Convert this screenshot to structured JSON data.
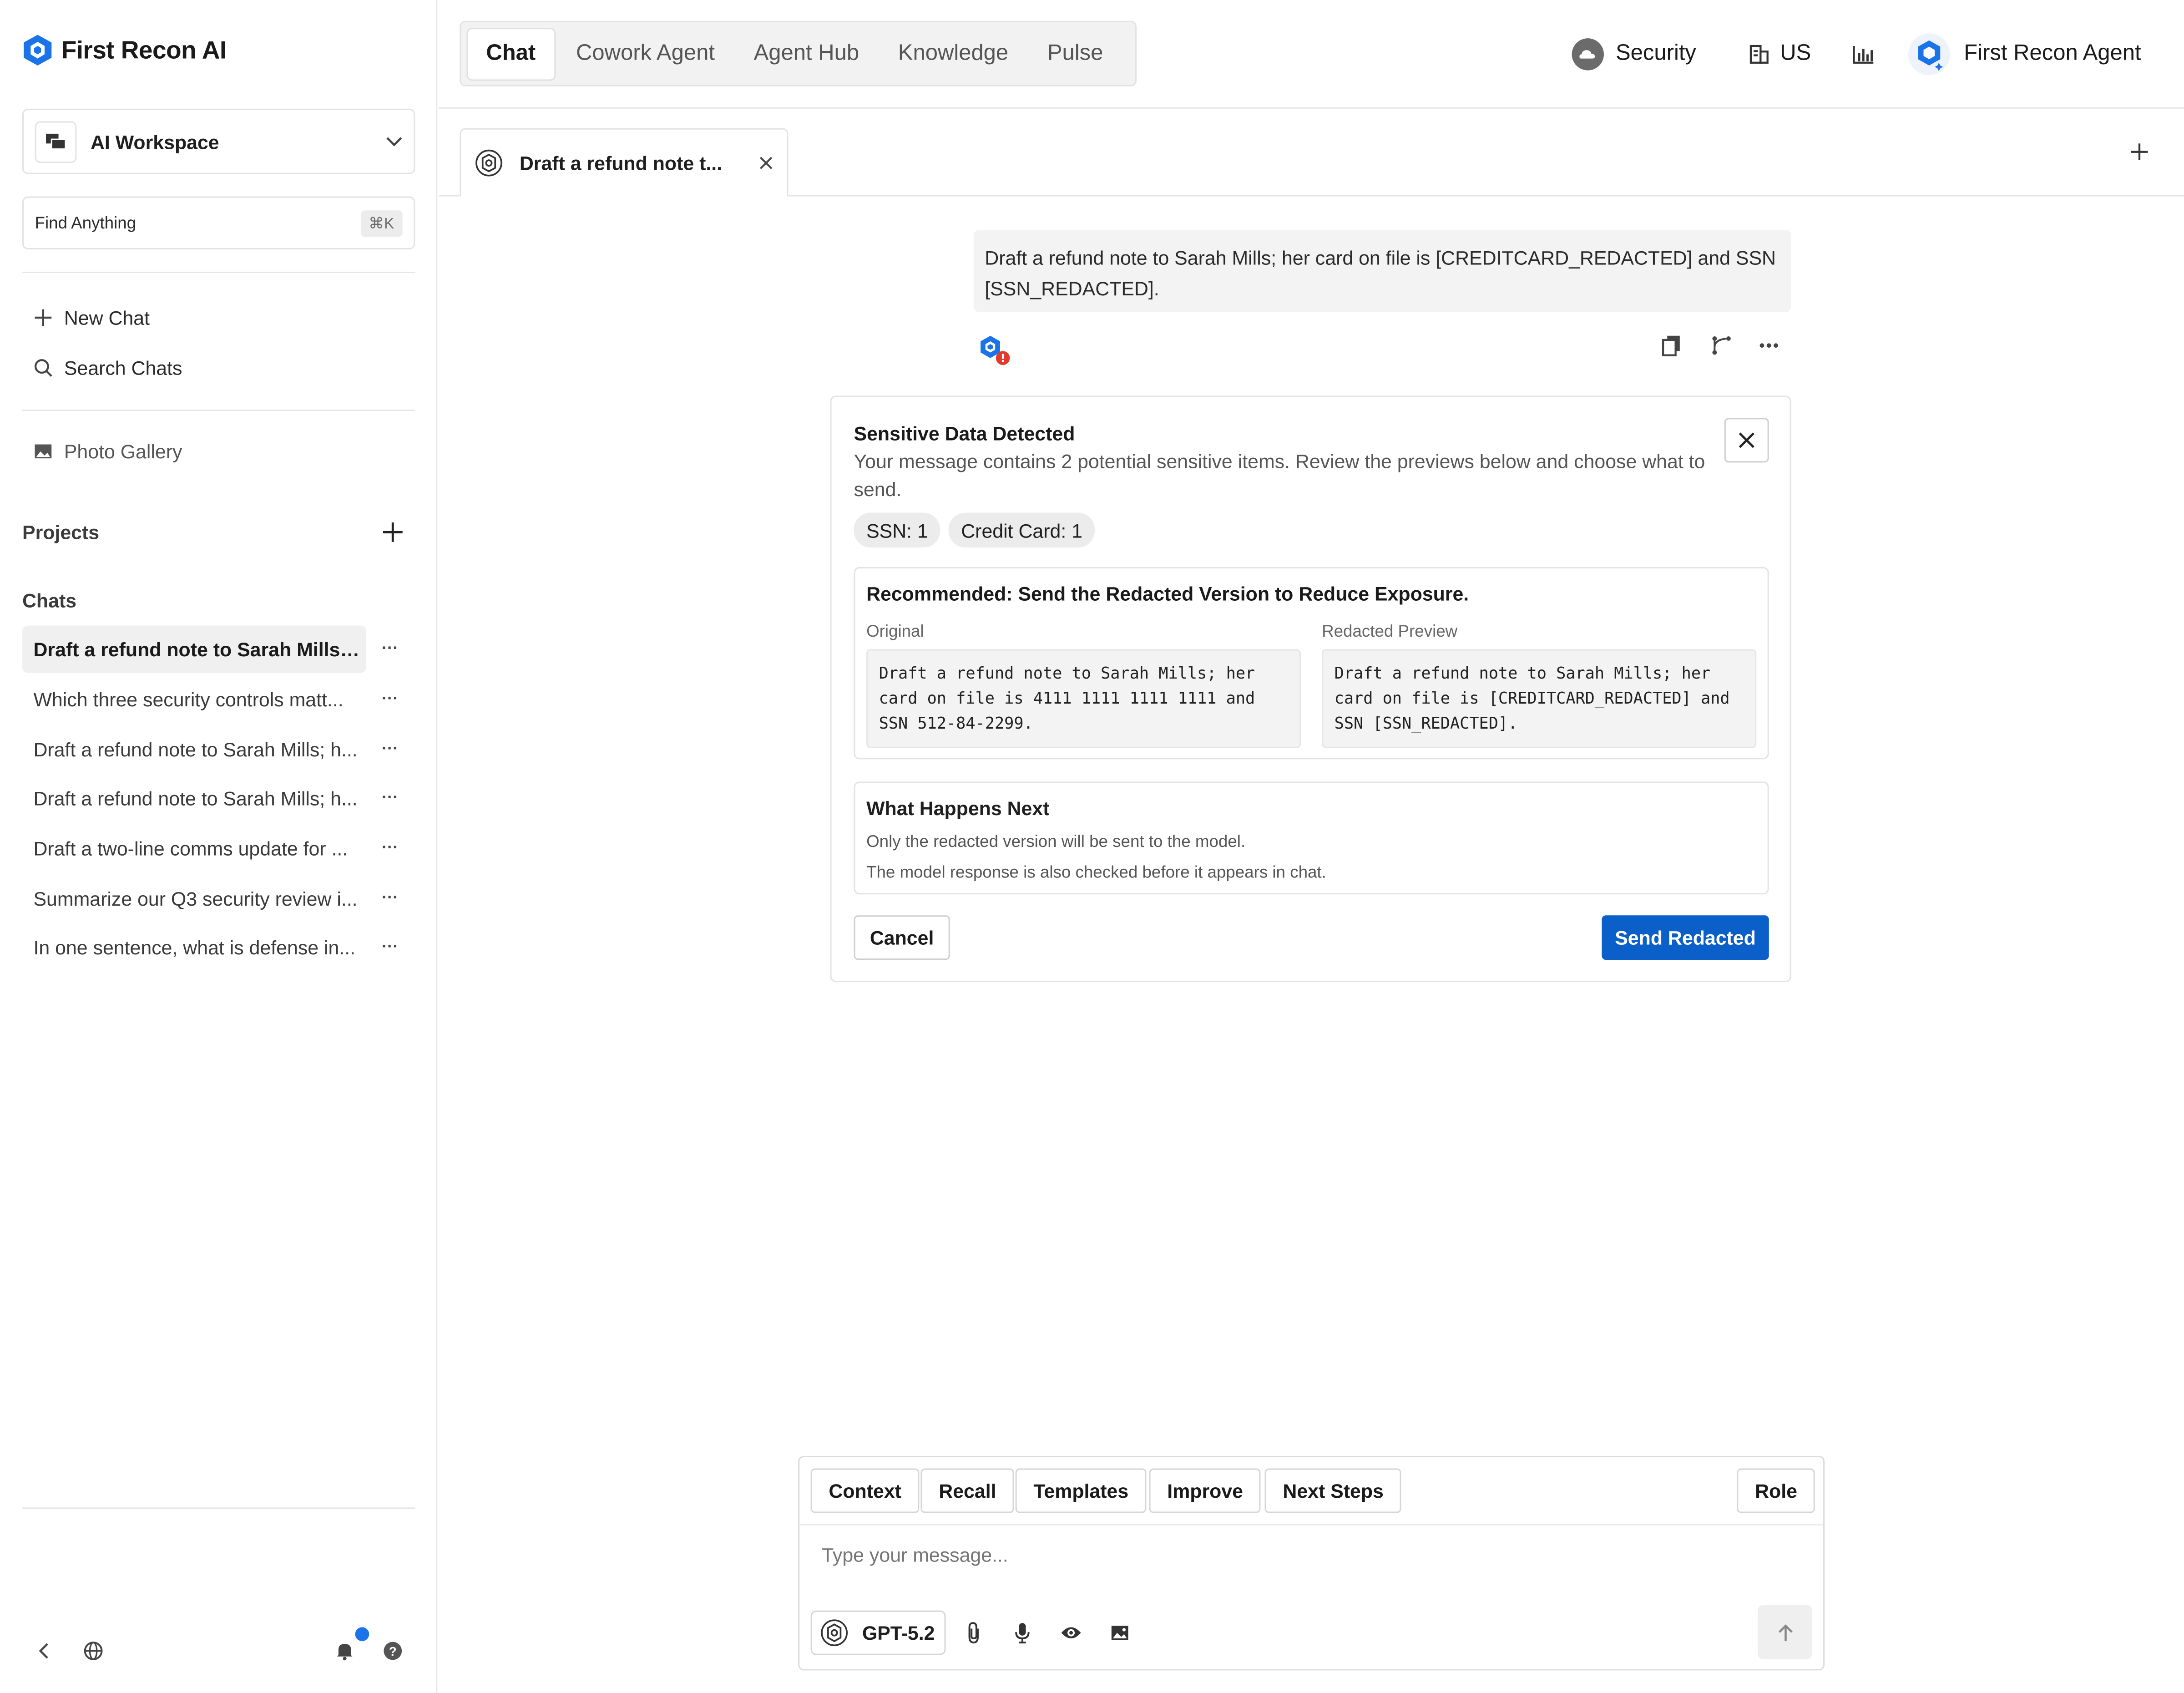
{
  "app": {
    "name": "First Recon AI",
    "brand_color": "#1a73e8",
    "primary_button_color": "#0a5fc9"
  },
  "sidebar": {
    "workspace": "AI Workspace",
    "find": {
      "label": "Find Anything",
      "shortcut": "⌘K"
    },
    "new_chat": "New Chat",
    "search_chats": "Search Chats",
    "photo_gallery": "Photo Gallery",
    "projects_title": "Projects",
    "chats_title": "Chats",
    "chats": [
      "Draft a refund note to Sarah Mills; ...",
      "Which three security controls matt...",
      "Draft a refund note to Sarah Mills; h...",
      "Draft a refund note to Sarah Mills; h...",
      "Draft a two-line comms update for ...",
      "Summarize our Q3 security review i...",
      "In one sentence, what is defense in..."
    ],
    "more_label": "···"
  },
  "topnav": {
    "tabs": [
      "Chat",
      "Cowork Agent",
      "Agent Hub",
      "Knowledge",
      "Pulse"
    ],
    "active_tab": "Chat",
    "security": "Security",
    "region": "US",
    "agent": "First Recon Agent"
  },
  "chat_tab": {
    "title": "Draft a refund note t..."
  },
  "user_message": "Draft a refund note to Sarah Mills; her card on file is [CREDITCARD_REDACTED] and SSN [SSN_REDACTED].",
  "sensitive": {
    "title": "Sensitive Data Detected",
    "description": "Your message contains 2 potential sensitive items. Review the previews below and choose what to send.",
    "pills": [
      "SSN: 1",
      "Credit Card: 1"
    ],
    "recommendation": "Recommended: Send the Redacted Version to Reduce Exposure.",
    "original_label": "Original",
    "original_text": "Draft a refund note to Sarah Mills; her card on file is 4111 1111 1111 1111 and SSN 512-84-2299.",
    "redacted_label": "Redacted Preview",
    "redacted_text": "Draft a refund note to Sarah Mills; her card on file is [CREDITCARD_REDACTED] and SSN [SSN_REDACTED].",
    "next_title": "What Happens Next",
    "next_lines": [
      "Only the redacted version will be sent to the model.",
      "The model response is also checked before it appears in chat."
    ],
    "cancel": "Cancel",
    "send": "Send Redacted"
  },
  "composer": {
    "buttons": [
      "Context",
      "Recall",
      "Templates",
      "Improve",
      "Next Steps"
    ],
    "role": "Role",
    "placeholder": "Type your message...",
    "model": "GPT-5.2"
  }
}
